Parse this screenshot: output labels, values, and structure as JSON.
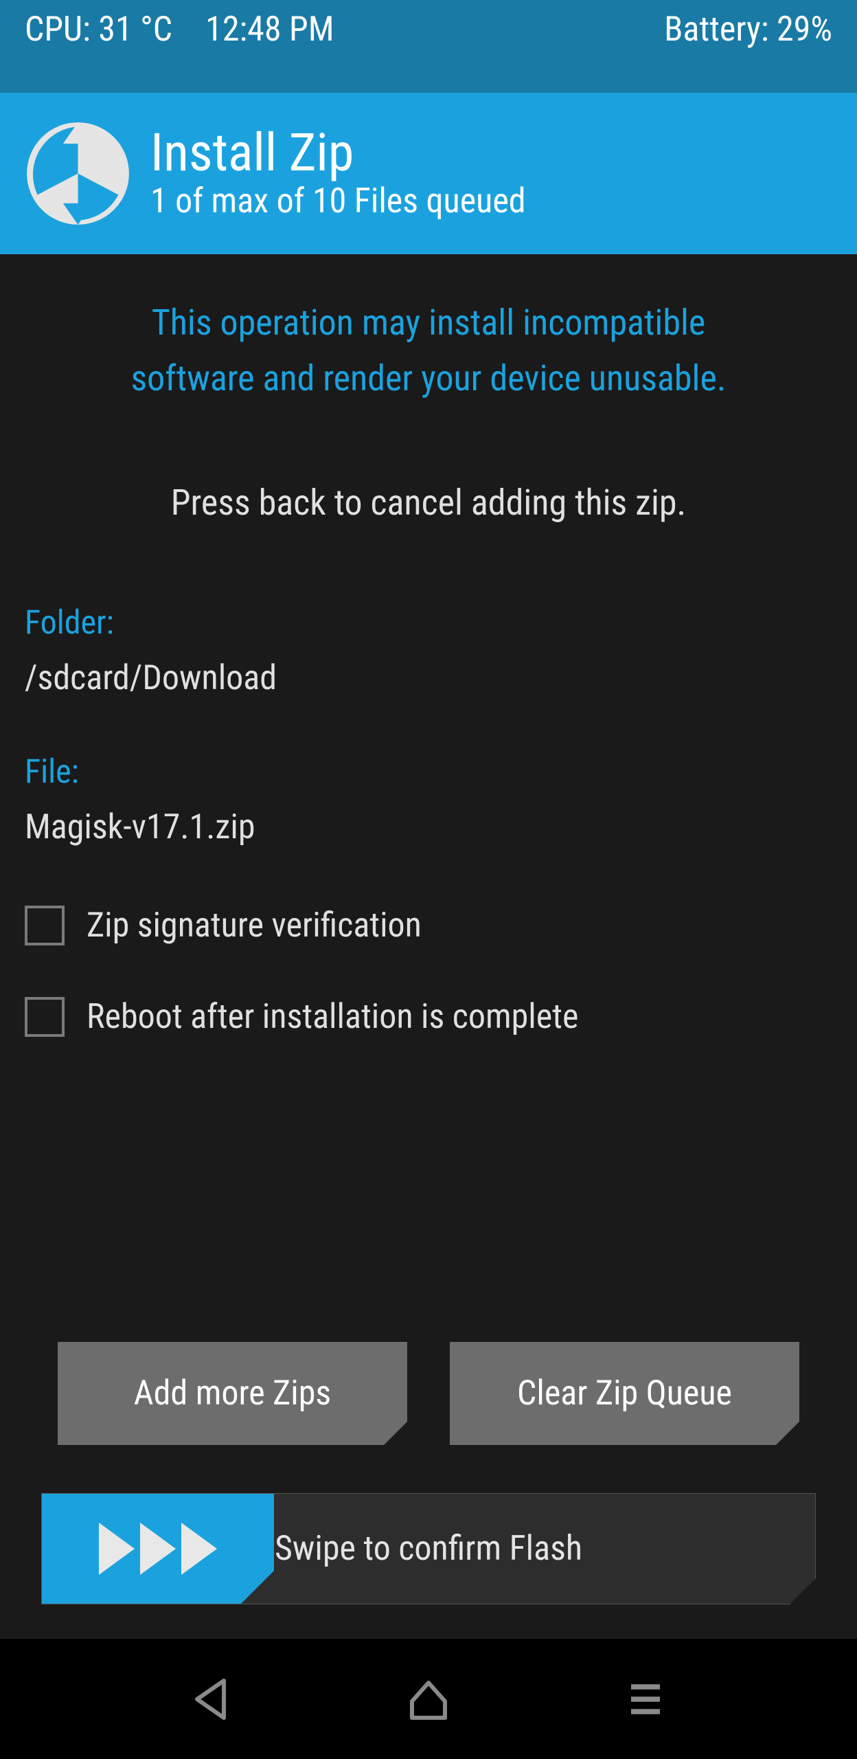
{
  "status": {
    "cpu": "CPU: 31 °C",
    "time": "12:48 PM",
    "battery": "Battery: 29%"
  },
  "header": {
    "title": "Install Zip",
    "subtitle": "1 of max of 10 Files queued"
  },
  "warning": {
    "line1": "This operation may install incompatible",
    "line2": "software and render your device unusable."
  },
  "instruction": "Press back to cancel adding this zip.",
  "folder": {
    "label": "Folder:",
    "value": "/sdcard/Download"
  },
  "file": {
    "label": "File:",
    "value": "Magisk-v17.1.zip"
  },
  "options": {
    "zip_verify": "Zip signature verification",
    "reboot_after": "Reboot after installation is complete"
  },
  "buttons": {
    "add_more": "Add more Zips",
    "clear_queue": "Clear Zip Queue"
  },
  "swipe": {
    "label": "Swipe to confirm Flash"
  }
}
